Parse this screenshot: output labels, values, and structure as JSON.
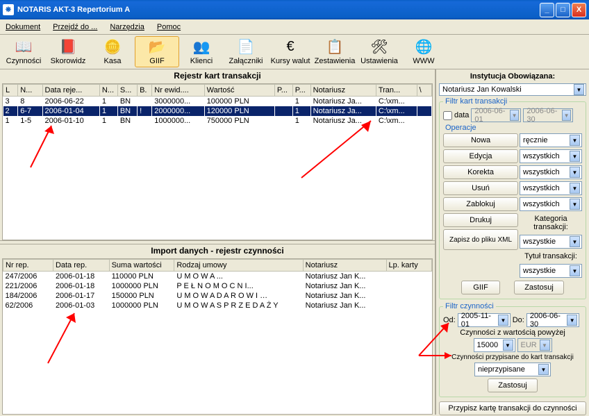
{
  "window": {
    "title": "NOTARIS AKT-3 Repertorium A"
  },
  "menu": [
    "Dokument",
    "Przejdź do ...",
    "Narzędzia",
    "Pomoc"
  ],
  "toolbar": [
    {
      "label": "Czynności",
      "icon": "📖"
    },
    {
      "label": "Skorowidz",
      "icon": "📕"
    },
    {
      "label": "Kasa",
      "icon": "🪙"
    },
    {
      "label": "GIIF",
      "icon": "📂",
      "active": true
    },
    {
      "label": "Klienci",
      "icon": "👥"
    },
    {
      "label": "Załączniki",
      "icon": "📄"
    },
    {
      "label": "Kursy walut",
      "icon": "€"
    },
    {
      "label": "Zestawienia",
      "icon": "📋"
    },
    {
      "label": "Ustawienia",
      "icon": "🛠"
    },
    {
      "label": "WWW",
      "icon": "🌐"
    }
  ],
  "top_panel": {
    "title": "Rejestr kart transakcji",
    "headers": [
      "L",
      "N...",
      "Data reje...",
      "N...",
      "S...",
      "B.",
      "Nr ewid....",
      "Wartość",
      "P...",
      "P...",
      "Notariusz",
      "Tran...",
      "\\"
    ],
    "rows": [
      [
        "3",
        "8",
        "2006-06-22",
        "1",
        "BN",
        "",
        "3000000...",
        "100000 PLN",
        "",
        "1",
        "Notariusz Ja...",
        "C:\\xm...",
        ""
      ],
      [
        "2",
        "6-7",
        "2006-01-04",
        "1",
        "BN",
        "!",
        "2000000...",
        "120000 PLN",
        "",
        "1",
        "Notariusz Ja...",
        "C:\\xm...",
        ""
      ],
      [
        "1",
        "1-5",
        "2006-01-10",
        "1",
        "BN",
        "",
        "1000000...",
        "750000 PLN",
        "",
        "1",
        "Notariusz Ja...",
        "C:\\xm...",
        ""
      ]
    ],
    "selected_row": 1
  },
  "bottom_panel": {
    "title": "Import danych - rejestr czynności",
    "headers": [
      "Nr rep.",
      "Data rep.",
      "Suma wartości",
      "Rodzaj umowy",
      "Notariusz",
      "Lp. karty"
    ],
    "rows": [
      [
        "247/2006",
        "2006-01-18",
        "110000 PLN",
        "U M O W A ...",
        "Notariusz Jan K...",
        ""
      ],
      [
        "221/2006",
        "2006-01-18",
        "1000000 PLN",
        "P E Ł N O M O C N I...",
        "Notariusz Jan K...",
        ""
      ],
      [
        "184/2006",
        "2006-01-17",
        "150000 PLN",
        "U M O W A  D A R O W I …",
        "Notariusz Jan K...",
        ""
      ],
      [
        "62/2006",
        "2006-01-03",
        "1000000 PLN",
        "U M O W A  S P R Z E D A Ż Y",
        "Notariusz Jan K...",
        ""
      ]
    ]
  },
  "side": {
    "inst_label": "Instytucja Obowiązana:",
    "inst_value": "Notariusz Jan Kowalski",
    "filtr_kart": "Filtr kart transakcji",
    "data_cb": "data",
    "date1": "2006-06-01",
    "date2": "2006-06-30",
    "operacje": "Operacje",
    "btns": {
      "nowa": "Nowa",
      "edycja": "Edycja",
      "korekta": "Korekta",
      "usun": "Usuń",
      "zablokuj": "Zablokuj",
      "drukuj": "Drukuj",
      "zapisz": "Zapisz do pliku XML",
      "giif": "GIIF",
      "zastosuj": "Zastosuj",
      "zastosuj2": "Zastosuj",
      "przypisz": "Przypisz kartę transakcji do czynności"
    },
    "combos": {
      "c1": "ręcznie",
      "c2": "wszystkich",
      "c3": "wszystkich",
      "c4": "wszystkich",
      "c5": "wszystkich"
    },
    "kat_lbl": "Kategoria transakcji:",
    "kat_val": "wszystkie",
    "tyt_lbl": "Tytuł transakcji:",
    "tyt_val": "wszystkie",
    "filtr_cz": "Filtr czynności",
    "od": "Od:",
    "od_val": "2005-11-01",
    "do": "Do:",
    "do_val": "2006-06-30",
    "cz_wart": "Czynności z wartością powyżej",
    "wart_val": "15000",
    "cur": "EUR",
    "cz_przyp": "Czynności przypisane do kart transakcji",
    "przyp_val": "nieprzypisane"
  }
}
